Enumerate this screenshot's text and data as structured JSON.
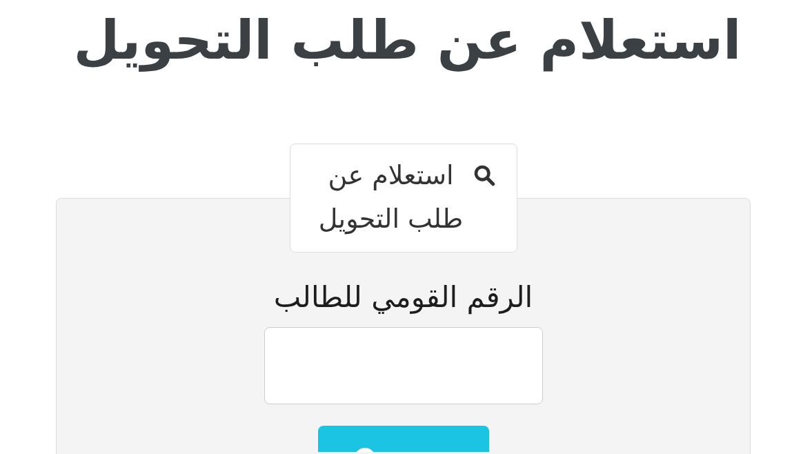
{
  "page_title": "استعلام عن طلب التحويل",
  "form": {
    "legend": "استعلام عن طلب التحويل",
    "national_id_field": {
      "label": "الرقم القومي للطالب"
    }
  }
}
